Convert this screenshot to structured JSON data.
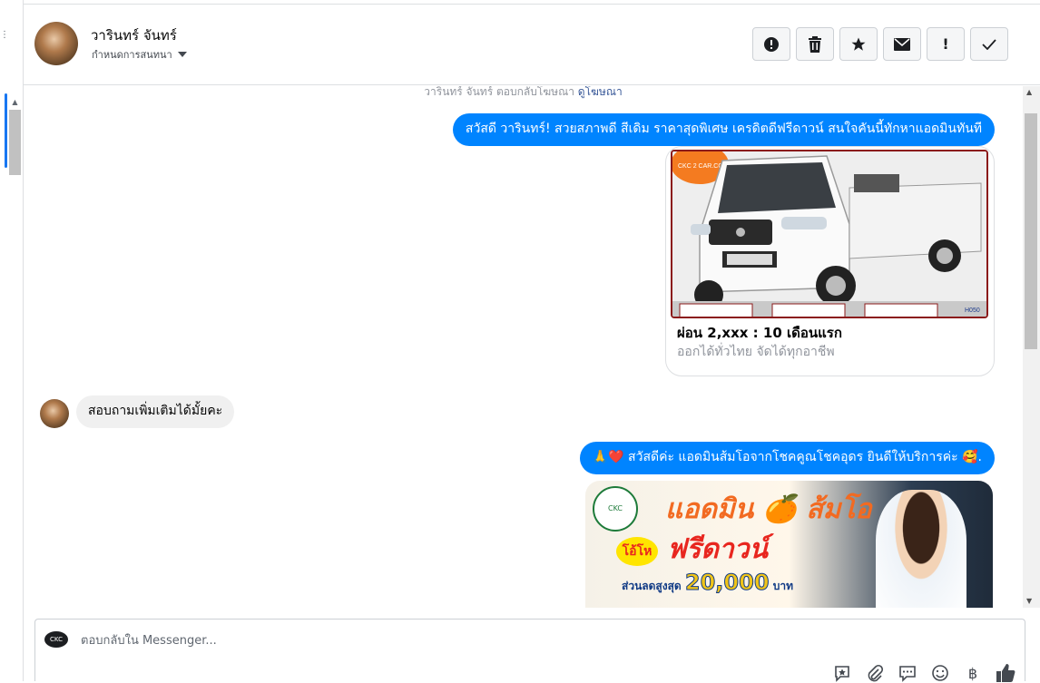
{
  "sidebar": {
    "icon": "more-icon"
  },
  "header": {
    "contact_name": "วารินทร์ จันทร์",
    "assign_label": "กำหนดการสนทนา",
    "actions": [
      {
        "name": "report-spam",
        "icon": "alert-circle-icon"
      },
      {
        "name": "delete",
        "icon": "trash-icon"
      },
      {
        "name": "star",
        "icon": "star-icon"
      },
      {
        "name": "mark-unread",
        "icon": "envelope-icon"
      },
      {
        "name": "mark-follow-up",
        "icon": "exclamation-icon",
        "glyph": "!"
      },
      {
        "name": "mark-done",
        "icon": "check-icon"
      }
    ]
  },
  "thread": {
    "ad_notice": {
      "prefix": "วารินทร์ จันทร์ ตอบกลับโฆษณา",
      "link": "ดูโฆษณา"
    },
    "messages": [
      {
        "direction": "out",
        "text": "สวัสดี วารินทร์! สวยสภาพดี สีเดิม ราคาสุดพิเศษ เครดิตดีฟรีดาวน์  สนใจคันนี้ทักหาแอดมินทันที"
      },
      {
        "direction": "in",
        "text": "สอบถามเพิ่มเติมได้มั้ยคะ"
      },
      {
        "direction": "out",
        "text": "🙏❤️ สวัสดีค่ะ แอดมินส้มโอจากโชคคูณโชคอุดร ยินดีให้บริการค่ะ  🥰."
      }
    ],
    "ad_card": {
      "image_label": "CKC 2 CAR.COM",
      "image_code": "H050",
      "title": "ผ่อน 2,xxx : 10 เดือนแรก",
      "subtitle": "ออกได้ทั่วไทย จัดได้ทุกอาชีพ"
    },
    "promo_image": {
      "line1": "แอดมิน 🍊 ส้มโอ",
      "badge": "โอ้โห",
      "line2": "ฟรีดาวน์",
      "line3_prefix": "ส่วนลดสูงสุด",
      "line3_amount": "20,000",
      "line3_suffix": "บาท",
      "logo_text": "CKC"
    }
  },
  "composer": {
    "placeholder": "ตอบกลับใน Messenger...",
    "avatar_text": "CKC",
    "tools": [
      {
        "name": "saved-reply",
        "icon": "saved-reply-icon"
      },
      {
        "name": "attach",
        "icon": "paperclip-icon"
      },
      {
        "name": "quick-reply",
        "icon": "chat-bubble-icon"
      },
      {
        "name": "emoji",
        "icon": "smiley-icon"
      },
      {
        "name": "payment",
        "icon": "baht-icon",
        "glyph": "฿"
      },
      {
        "name": "like",
        "icon": "thumbs-up-icon"
      }
    ]
  },
  "colors": {
    "outgoing_bubble": "#0084ff",
    "incoming_bubble": "#f0f0f0",
    "link": "#385898"
  }
}
